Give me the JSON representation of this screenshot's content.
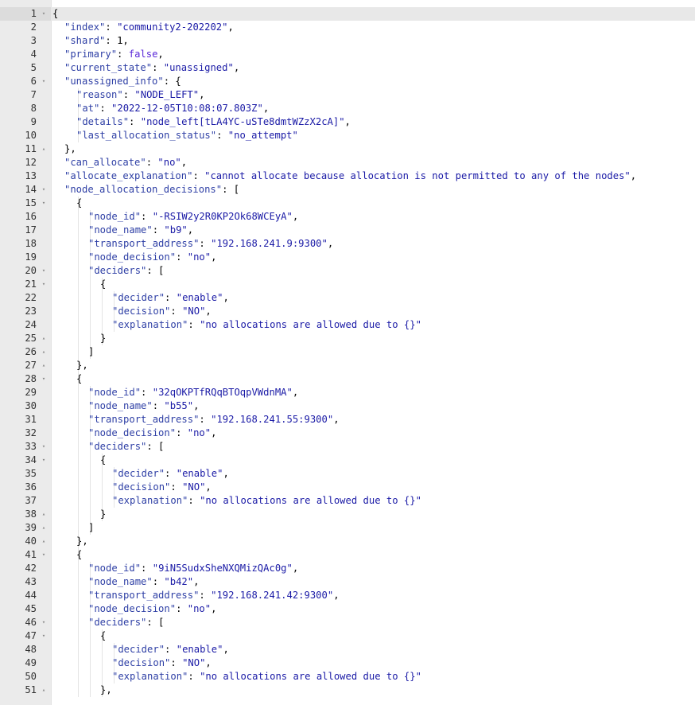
{
  "editor": {
    "lines": [
      {
        "n": "1",
        "fold": "▾",
        "indent": 0,
        "tokens": [
          {
            "t": "{",
            "c": "punc"
          }
        ]
      },
      {
        "n": "2",
        "fold": "",
        "indent": 1,
        "tokens": [
          {
            "t": "\"index\"",
            "c": "key"
          },
          {
            "t": ": ",
            "c": "punc"
          },
          {
            "t": "\"community2-202202\"",
            "c": "str"
          },
          {
            "t": ",",
            "c": "punc"
          }
        ]
      },
      {
        "n": "3",
        "fold": "",
        "indent": 1,
        "tokens": [
          {
            "t": "\"shard\"",
            "c": "key"
          },
          {
            "t": ": ",
            "c": "punc"
          },
          {
            "t": "1",
            "c": "num"
          },
          {
            "t": ",",
            "c": "punc"
          }
        ]
      },
      {
        "n": "4",
        "fold": "",
        "indent": 1,
        "tokens": [
          {
            "t": "\"primary\"",
            "c": "key"
          },
          {
            "t": ": ",
            "c": "punc"
          },
          {
            "t": "false",
            "c": "bool"
          },
          {
            "t": ",",
            "c": "punc"
          }
        ]
      },
      {
        "n": "5",
        "fold": "",
        "indent": 1,
        "tokens": [
          {
            "t": "\"current_state\"",
            "c": "key"
          },
          {
            "t": ": ",
            "c": "punc"
          },
          {
            "t": "\"unassigned\"",
            "c": "str"
          },
          {
            "t": ",",
            "c": "punc"
          }
        ]
      },
      {
        "n": "6",
        "fold": "▾",
        "indent": 1,
        "tokens": [
          {
            "t": "\"unassigned_info\"",
            "c": "key"
          },
          {
            "t": ": {",
            "c": "punc"
          }
        ]
      },
      {
        "n": "7",
        "fold": "",
        "indent": 2,
        "tokens": [
          {
            "t": "\"reason\"",
            "c": "key"
          },
          {
            "t": ": ",
            "c": "punc"
          },
          {
            "t": "\"NODE_LEFT\"",
            "c": "str"
          },
          {
            "t": ",",
            "c": "punc"
          }
        ]
      },
      {
        "n": "8",
        "fold": "",
        "indent": 2,
        "tokens": [
          {
            "t": "\"at\"",
            "c": "key"
          },
          {
            "t": ": ",
            "c": "punc"
          },
          {
            "t": "\"2022-12-05T10:08:07.803Z\"",
            "c": "str"
          },
          {
            "t": ",",
            "c": "punc"
          }
        ]
      },
      {
        "n": "9",
        "fold": "",
        "indent": 2,
        "tokens": [
          {
            "t": "\"details\"",
            "c": "key"
          },
          {
            "t": ": ",
            "c": "punc"
          },
          {
            "t": "\"node_left[tLA4YC-uSTe8dmtWZzX2cA]\"",
            "c": "str"
          },
          {
            "t": ",",
            "c": "punc"
          }
        ]
      },
      {
        "n": "10",
        "fold": "",
        "indent": 2,
        "tokens": [
          {
            "t": "\"last_allocation_status\"",
            "c": "key"
          },
          {
            "t": ": ",
            "c": "punc"
          },
          {
            "t": "\"no_attempt\"",
            "c": "str"
          }
        ]
      },
      {
        "n": "11",
        "fold": "▴",
        "indent": 1,
        "tokens": [
          {
            "t": "},",
            "c": "punc"
          }
        ]
      },
      {
        "n": "12",
        "fold": "",
        "indent": 1,
        "tokens": [
          {
            "t": "\"can_allocate\"",
            "c": "key"
          },
          {
            "t": ": ",
            "c": "punc"
          },
          {
            "t": "\"no\"",
            "c": "str"
          },
          {
            "t": ",",
            "c": "punc"
          }
        ]
      },
      {
        "n": "13",
        "fold": "",
        "indent": 1,
        "tokens": [
          {
            "t": "\"allocate_explanation\"",
            "c": "key"
          },
          {
            "t": ": ",
            "c": "punc"
          },
          {
            "t": "\"cannot allocate because allocation is not permitted to any of the nodes\"",
            "c": "str"
          },
          {
            "t": ",",
            "c": "punc"
          }
        ]
      },
      {
        "n": "14",
        "fold": "▾",
        "indent": 1,
        "tokens": [
          {
            "t": "\"node_allocation_decisions\"",
            "c": "key"
          },
          {
            "t": ": [",
            "c": "punc"
          }
        ]
      },
      {
        "n": "15",
        "fold": "▾",
        "indent": 2,
        "tokens": [
          {
            "t": "{",
            "c": "punc"
          }
        ]
      },
      {
        "n": "16",
        "fold": "",
        "indent": 3,
        "tokens": [
          {
            "t": "\"node_id\"",
            "c": "key"
          },
          {
            "t": ": ",
            "c": "punc"
          },
          {
            "t": "\"-RSIW2y2R0KP2Ok68WCEyA\"",
            "c": "str"
          },
          {
            "t": ",",
            "c": "punc"
          }
        ]
      },
      {
        "n": "17",
        "fold": "",
        "indent": 3,
        "tokens": [
          {
            "t": "\"node_name\"",
            "c": "key"
          },
          {
            "t": ": ",
            "c": "punc"
          },
          {
            "t": "\"b9\"",
            "c": "str"
          },
          {
            "t": ",",
            "c": "punc"
          }
        ]
      },
      {
        "n": "18",
        "fold": "",
        "indent": 3,
        "tokens": [
          {
            "t": "\"transport_address\"",
            "c": "key"
          },
          {
            "t": ": ",
            "c": "punc"
          },
          {
            "t": "\"192.168.241.9:9300\"",
            "c": "str"
          },
          {
            "t": ",",
            "c": "punc"
          }
        ]
      },
      {
        "n": "19",
        "fold": "",
        "indent": 3,
        "tokens": [
          {
            "t": "\"node_decision\"",
            "c": "key"
          },
          {
            "t": ": ",
            "c": "punc"
          },
          {
            "t": "\"no\"",
            "c": "str"
          },
          {
            "t": ",",
            "c": "punc"
          }
        ]
      },
      {
        "n": "20",
        "fold": "▾",
        "indent": 3,
        "tokens": [
          {
            "t": "\"deciders\"",
            "c": "key"
          },
          {
            "t": ": [",
            "c": "punc"
          }
        ]
      },
      {
        "n": "21",
        "fold": "▾",
        "indent": 4,
        "tokens": [
          {
            "t": "{",
            "c": "punc"
          }
        ]
      },
      {
        "n": "22",
        "fold": "",
        "indent": 5,
        "tokens": [
          {
            "t": "\"decider\"",
            "c": "key"
          },
          {
            "t": ": ",
            "c": "punc"
          },
          {
            "t": "\"enable\"",
            "c": "str"
          },
          {
            "t": ",",
            "c": "punc"
          }
        ]
      },
      {
        "n": "23",
        "fold": "",
        "indent": 5,
        "tokens": [
          {
            "t": "\"decision\"",
            "c": "key"
          },
          {
            "t": ": ",
            "c": "punc"
          },
          {
            "t": "\"NO\"",
            "c": "str"
          },
          {
            "t": ",",
            "c": "punc"
          }
        ]
      },
      {
        "n": "24",
        "fold": "",
        "indent": 5,
        "tokens": [
          {
            "t": "\"explanation\"",
            "c": "key"
          },
          {
            "t": ": ",
            "c": "punc"
          },
          {
            "t": "\"no allocations are allowed due to {}\"",
            "c": "str"
          }
        ]
      },
      {
        "n": "25",
        "fold": "▴",
        "indent": 4,
        "tokens": [
          {
            "t": "}",
            "c": "punc"
          }
        ]
      },
      {
        "n": "26",
        "fold": "▴",
        "indent": 3,
        "tokens": [
          {
            "t": "]",
            "c": "punc"
          }
        ]
      },
      {
        "n": "27",
        "fold": "▴",
        "indent": 2,
        "tokens": [
          {
            "t": "},",
            "c": "punc"
          }
        ]
      },
      {
        "n": "28",
        "fold": "▾",
        "indent": 2,
        "tokens": [
          {
            "t": "{",
            "c": "punc"
          }
        ]
      },
      {
        "n": "29",
        "fold": "",
        "indent": 3,
        "tokens": [
          {
            "t": "\"node_id\"",
            "c": "key"
          },
          {
            "t": ": ",
            "c": "punc"
          },
          {
            "t": "\"32qOKPTfRQqBTOqpVWdnMA\"",
            "c": "str"
          },
          {
            "t": ",",
            "c": "punc"
          }
        ]
      },
      {
        "n": "30",
        "fold": "",
        "indent": 3,
        "tokens": [
          {
            "t": "\"node_name\"",
            "c": "key"
          },
          {
            "t": ": ",
            "c": "punc"
          },
          {
            "t": "\"b55\"",
            "c": "str"
          },
          {
            "t": ",",
            "c": "punc"
          }
        ]
      },
      {
        "n": "31",
        "fold": "",
        "indent": 3,
        "tokens": [
          {
            "t": "\"transport_address\"",
            "c": "key"
          },
          {
            "t": ": ",
            "c": "punc"
          },
          {
            "t": "\"192.168.241.55:9300\"",
            "c": "str"
          },
          {
            "t": ",",
            "c": "punc"
          }
        ]
      },
      {
        "n": "32",
        "fold": "",
        "indent": 3,
        "tokens": [
          {
            "t": "\"node_decision\"",
            "c": "key"
          },
          {
            "t": ": ",
            "c": "punc"
          },
          {
            "t": "\"no\"",
            "c": "str"
          },
          {
            "t": ",",
            "c": "punc"
          }
        ]
      },
      {
        "n": "33",
        "fold": "▾",
        "indent": 3,
        "tokens": [
          {
            "t": "\"deciders\"",
            "c": "key"
          },
          {
            "t": ": [",
            "c": "punc"
          }
        ]
      },
      {
        "n": "34",
        "fold": "▾",
        "indent": 4,
        "tokens": [
          {
            "t": "{",
            "c": "punc"
          }
        ]
      },
      {
        "n": "35",
        "fold": "",
        "indent": 5,
        "tokens": [
          {
            "t": "\"decider\"",
            "c": "key"
          },
          {
            "t": ": ",
            "c": "punc"
          },
          {
            "t": "\"enable\"",
            "c": "str"
          },
          {
            "t": ",",
            "c": "punc"
          }
        ]
      },
      {
        "n": "36",
        "fold": "",
        "indent": 5,
        "tokens": [
          {
            "t": "\"decision\"",
            "c": "key"
          },
          {
            "t": ": ",
            "c": "punc"
          },
          {
            "t": "\"NO\"",
            "c": "str"
          },
          {
            "t": ",",
            "c": "punc"
          }
        ]
      },
      {
        "n": "37",
        "fold": "",
        "indent": 5,
        "tokens": [
          {
            "t": "\"explanation\"",
            "c": "key"
          },
          {
            "t": ": ",
            "c": "punc"
          },
          {
            "t": "\"no allocations are allowed due to {}\"",
            "c": "str"
          }
        ]
      },
      {
        "n": "38",
        "fold": "▴",
        "indent": 4,
        "tokens": [
          {
            "t": "}",
            "c": "punc"
          }
        ]
      },
      {
        "n": "39",
        "fold": "▴",
        "indent": 3,
        "tokens": [
          {
            "t": "]",
            "c": "punc"
          }
        ]
      },
      {
        "n": "40",
        "fold": "▴",
        "indent": 2,
        "tokens": [
          {
            "t": "},",
            "c": "punc"
          }
        ]
      },
      {
        "n": "41",
        "fold": "▾",
        "indent": 2,
        "tokens": [
          {
            "t": "{",
            "c": "punc"
          }
        ]
      },
      {
        "n": "42",
        "fold": "",
        "indent": 3,
        "tokens": [
          {
            "t": "\"node_id\"",
            "c": "key"
          },
          {
            "t": ": ",
            "c": "punc"
          },
          {
            "t": "\"9iN5SudxSheNXQMizQAc0g\"",
            "c": "str"
          },
          {
            "t": ",",
            "c": "punc"
          }
        ]
      },
      {
        "n": "43",
        "fold": "",
        "indent": 3,
        "tokens": [
          {
            "t": "\"node_name\"",
            "c": "key"
          },
          {
            "t": ": ",
            "c": "punc"
          },
          {
            "t": "\"b42\"",
            "c": "str"
          },
          {
            "t": ",",
            "c": "punc"
          }
        ]
      },
      {
        "n": "44",
        "fold": "",
        "indent": 3,
        "tokens": [
          {
            "t": "\"transport_address\"",
            "c": "key"
          },
          {
            "t": ": ",
            "c": "punc"
          },
          {
            "t": "\"192.168.241.42:9300\"",
            "c": "str"
          },
          {
            "t": ",",
            "c": "punc"
          }
        ]
      },
      {
        "n": "45",
        "fold": "",
        "indent": 3,
        "tokens": [
          {
            "t": "\"node_decision\"",
            "c": "key"
          },
          {
            "t": ": ",
            "c": "punc"
          },
          {
            "t": "\"no\"",
            "c": "str"
          },
          {
            "t": ",",
            "c": "punc"
          }
        ]
      },
      {
        "n": "46",
        "fold": "▾",
        "indent": 3,
        "tokens": [
          {
            "t": "\"deciders\"",
            "c": "key"
          },
          {
            "t": ": [",
            "c": "punc"
          }
        ]
      },
      {
        "n": "47",
        "fold": "▾",
        "indent": 4,
        "tokens": [
          {
            "t": "{",
            "c": "punc"
          }
        ]
      },
      {
        "n": "48",
        "fold": "",
        "indent": 5,
        "tokens": [
          {
            "t": "\"decider\"",
            "c": "key"
          },
          {
            "t": ": ",
            "c": "punc"
          },
          {
            "t": "\"enable\"",
            "c": "str"
          },
          {
            "t": ",",
            "c": "punc"
          }
        ]
      },
      {
        "n": "49",
        "fold": "",
        "indent": 5,
        "tokens": [
          {
            "t": "\"decision\"",
            "c": "key"
          },
          {
            "t": ": ",
            "c": "punc"
          },
          {
            "t": "\"NO\"",
            "c": "str"
          },
          {
            "t": ",",
            "c": "punc"
          }
        ]
      },
      {
        "n": "50",
        "fold": "",
        "indent": 5,
        "tokens": [
          {
            "t": "\"explanation\"",
            "c": "key"
          },
          {
            "t": ": ",
            "c": "punc"
          },
          {
            "t": "\"no allocations are allowed due to {}\"",
            "c": "str"
          }
        ]
      },
      {
        "n": "51",
        "fold": "▴",
        "indent": 4,
        "tokens": [
          {
            "t": "},",
            "c": "punc"
          }
        ]
      }
    ],
    "active_line": 0,
    "colors": {
      "key": "#2e3fa5",
      "string": "#1a1aa6",
      "boolean": "#5a28d8",
      "gutter": "#ebebeb",
      "active_line": "#e8e8e8"
    }
  }
}
